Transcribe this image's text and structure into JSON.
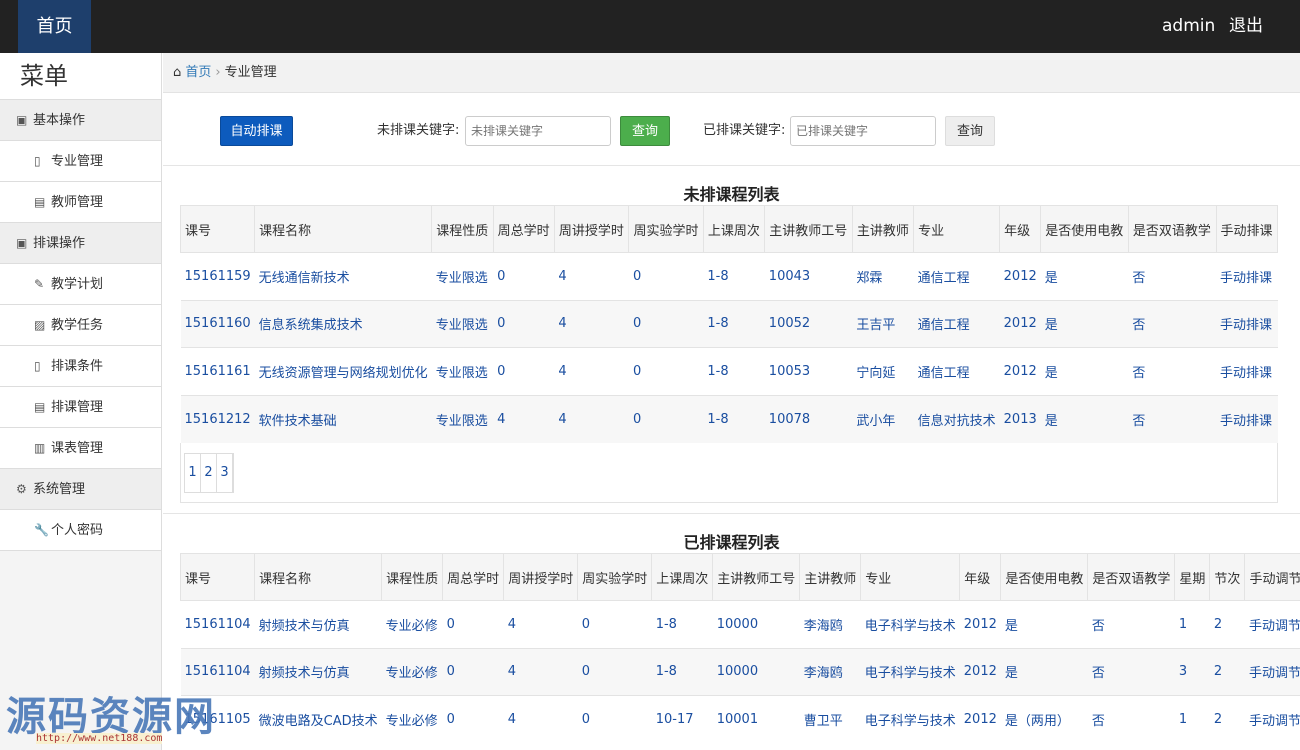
{
  "topbar": {
    "home": "首页",
    "user": "admin",
    "logout": "退出"
  },
  "sidebar": {
    "title": "菜单",
    "groups": [
      {
        "label": "基本操作",
        "items": [
          "专业管理",
          "教师管理"
        ]
      },
      {
        "label": "排课操作",
        "items": [
          "教学计划",
          "教学任务",
          "排课条件",
          "排课管理",
          "课表管理"
        ]
      },
      {
        "label": "系统管理",
        "items": [
          "个人密码"
        ]
      }
    ]
  },
  "breadcrumb": {
    "home": "首页",
    "current": "专业管理"
  },
  "toolbar": {
    "auto_button": "自动排课",
    "unsched_label": "未排课关键字:",
    "unsched_placeholder": "未排课关键字",
    "query1": "查询",
    "sched_label": "已排课关键字:",
    "sched_placeholder": "已排课关键字",
    "query2": "查询"
  },
  "unscheduled": {
    "title": "未排课程列表",
    "headers": [
      "课号",
      "课程名称",
      "课程性质",
      "周总学时",
      "周讲授学时",
      "周实验学时",
      "上课周次",
      "主讲教师工号",
      "主讲教师",
      "专业",
      "年级",
      "是否使用电教",
      "是否双语教学",
      "手动排课"
    ],
    "rows": [
      [
        "15161159",
        "无线通信新技术",
        "专业限选",
        "0",
        "4",
        "0",
        "1-8",
        "10043",
        "郑霖",
        "通信工程",
        "2012",
        "是",
        "否",
        "手动排课"
      ],
      [
        "15161160",
        "信息系统集成技术",
        "专业限选",
        "0",
        "4",
        "0",
        "1-8",
        "10052",
        "王吉平",
        "通信工程",
        "2012",
        "是",
        "否",
        "手动排课"
      ],
      [
        "15161161",
        "无线资源管理与网络规划优化",
        "专业限选",
        "0",
        "4",
        "0",
        "1-8",
        "10053",
        "宁向延",
        "通信工程",
        "2012",
        "是",
        "否",
        "手动排课"
      ],
      [
        "15161212",
        "软件技术基础",
        "专业限选",
        "4",
        "4",
        "0",
        "1-8",
        "10078",
        "武小年",
        "信息对抗技术",
        "2013",
        "是",
        "否",
        "手动排课"
      ]
    ],
    "pages": [
      "1",
      "2",
      "3"
    ]
  },
  "scheduled": {
    "title": "已排课程列表",
    "headers": [
      "课号",
      "课程名称",
      "课程性质",
      "周总学时",
      "周讲授学时",
      "周实验学时",
      "上课周次",
      "主讲教师工号",
      "主讲教师",
      "专业",
      "年级",
      "是否使用电教",
      "是否双语教学",
      "星期",
      "节次",
      "手动调节"
    ],
    "rows": [
      [
        "15161104",
        "射频技术与仿真",
        "专业必修",
        "0",
        "4",
        "0",
        "1-8",
        "10000",
        "李海鸥",
        "电子科学与技术",
        "2012",
        "是",
        "否",
        "1",
        "2",
        "手动调节"
      ],
      [
        "15161104",
        "射频技术与仿真",
        "专业必修",
        "0",
        "4",
        "0",
        "1-8",
        "10000",
        "李海鸥",
        "电子科学与技术",
        "2012",
        "是",
        "否",
        "3",
        "2",
        "手动调节"
      ],
      [
        "15161105",
        "微波电路及CAD技术",
        "专业必修",
        "0",
        "4",
        "0",
        "10-17",
        "10001",
        "曹卫平",
        "电子科学与技术",
        "2012",
        "是（两用）",
        "否",
        "1",
        "2",
        "手动调节"
      ]
    ]
  },
  "watermark": {
    "text": "源码资源网",
    "url": "http://www.net188.com"
  }
}
